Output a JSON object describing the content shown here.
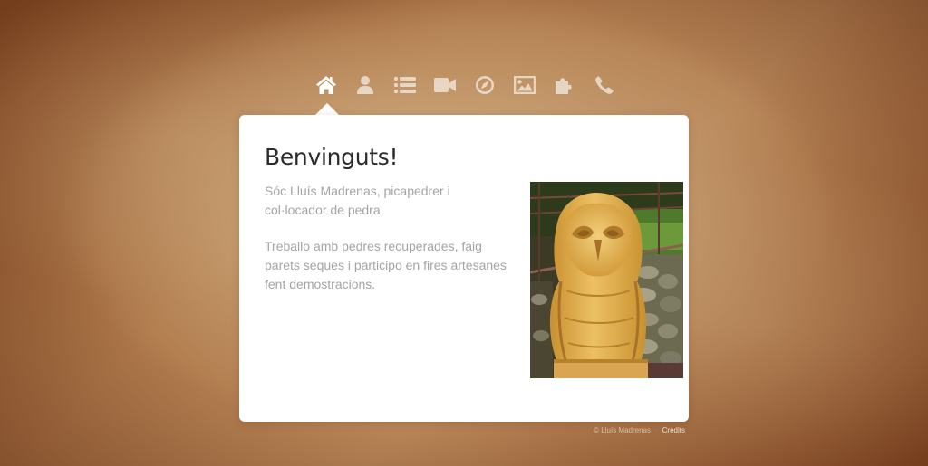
{
  "nav": {
    "items": [
      {
        "icon": "home-icon",
        "active": true
      },
      {
        "icon": "user-icon",
        "active": false
      },
      {
        "icon": "list-icon",
        "active": false
      },
      {
        "icon": "video-camera-icon",
        "active": false
      },
      {
        "icon": "compass-icon",
        "active": false
      },
      {
        "icon": "image-icon",
        "active": false
      },
      {
        "icon": "puzzle-icon",
        "active": false
      },
      {
        "icon": "phone-icon",
        "active": false
      }
    ]
  },
  "content": {
    "title": "Benvinguts!",
    "paragraphs": [
      "Sóc Lluís Madrenas, picapedrer i col·locador de pedra.",
      "Treballo amb pedres recuperades, faig parets seques i participo en fires artesanes fent demostracions."
    ],
    "photo_subject": "stone owl sculpture"
  },
  "footer": {
    "copyright": "© Lluís Madrenas",
    "separator": "·",
    "credits": "Crèdits"
  },
  "colors": {
    "panel": "#ffffff",
    "title": "#2b2b2b",
    "body_text": "#a2a4a8",
    "nav_active": "#ffffff",
    "background": "#9a6a40"
  }
}
